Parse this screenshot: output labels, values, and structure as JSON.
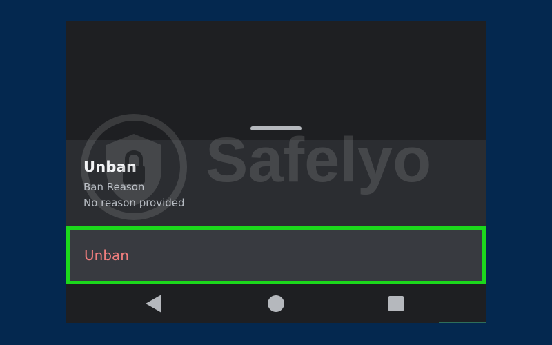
{
  "sheet": {
    "title": "Unban",
    "subtitle": "Ban Reason",
    "reason": "No reason provided"
  },
  "action": {
    "label": "Unban",
    "highlight_color": "#1cd81c",
    "text_color": "#f27e7e"
  },
  "watermark": {
    "text": "Safelyo",
    "icon": "shield-lock-icon"
  },
  "navigation": {
    "back_icon": "back-triangle-icon",
    "home_icon": "home-circle-icon",
    "recent_icon": "recents-square-icon"
  },
  "colors": {
    "page_background": "#04284f",
    "app_background": "#1e1f22",
    "sheet_background": "#2b2d31"
  }
}
